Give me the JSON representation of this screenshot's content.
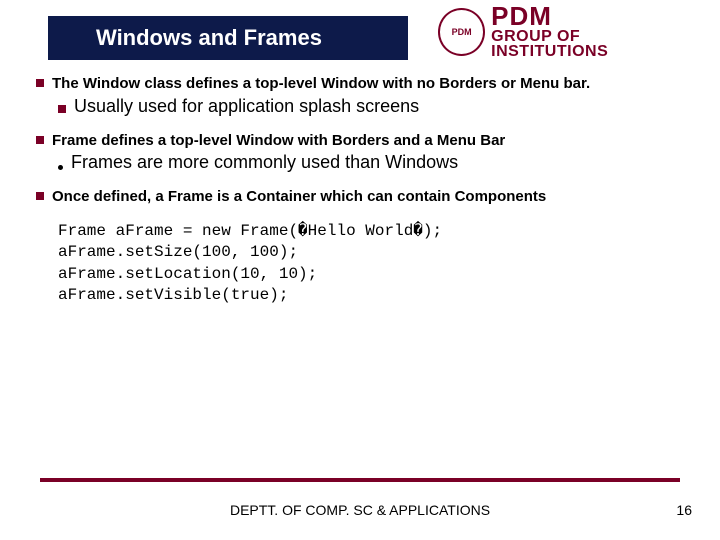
{
  "title": "Windows and Frames",
  "logo": {
    "top": "PDM",
    "bottom": "GROUP OF INSTITUTIONS",
    "seal": "PDM"
  },
  "bullets": [
    {
      "text": "The Window class defines a top-level Window with no Borders or Menu bar.",
      "sub": {
        "style": "square",
        "text": "Usually used for application splash screens"
      }
    },
    {
      "text": "Frame defines a top-level Window with Borders and a Menu Bar",
      "sub": {
        "style": "dot",
        "text": "Frames are more commonly used than Windows"
      }
    },
    {
      "text": "Once defined, a Frame is a Container which can contain Components",
      "code": "Frame aFrame = new Frame(�Hello World�);\naFrame.setSize(100, 100);\naFrame.setLocation(10, 10);\naFrame.setVisible(true);"
    }
  ],
  "footer": "DEPTT. OF COMP. SC & APPLICATIONS",
  "page_number": "16"
}
